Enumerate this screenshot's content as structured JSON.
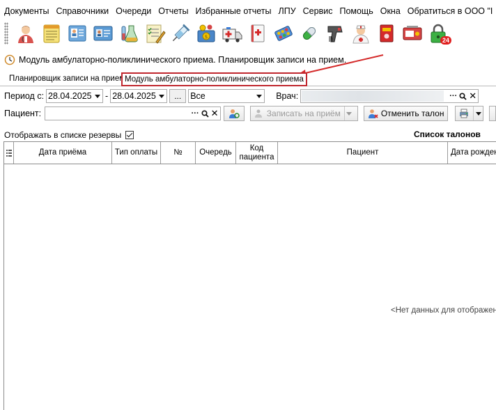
{
  "menu": {
    "items": [
      "Документы",
      "Справочники",
      "Очереди",
      "Отчеты",
      "Избранные отчеты",
      "ЛПУ",
      "Сервис",
      "Помощь",
      "Окна",
      "Обратиться в ООО \"I"
    ]
  },
  "toolbar": {
    "icons": [
      "doctor-icon",
      "notepad-icon",
      "contacts-card-icon",
      "id-card-icon",
      "lab-flask-icon",
      "checklist-icon",
      "syringe-icon",
      "money-box-icon",
      "ambulance-icon",
      "medical-book-icon",
      "pill-pack-icon",
      "capsule-icon",
      "barcode-scanner-icon",
      "nurse-icon",
      "red-book-icon",
      "card-reader-icon",
      "lock-notify-icon"
    ],
    "badge": "24"
  },
  "window": {
    "title": "Модуль амбулаторно-поликлинического приема. Планировщик записи на прием."
  },
  "tabs": [
    "Планировщик записи на прием",
    "Модуль амбулаторно-поликлинического приема"
  ],
  "filters": {
    "period_label": "Период с:",
    "date_from": "28.04.2025",
    "dash": "-",
    "date_to": "28.04.2025",
    "dots": "...",
    "payment_value": "Все",
    "doctor_label": "Врач:",
    "patient_label": "Пациент:",
    "ellipsis": "···",
    "clear": "✕"
  },
  "actions": {
    "book_label": "Записать на приём",
    "cancel_label": "Отменить талон"
  },
  "options": {
    "show_reserves_label": "Отображать в списке резервы",
    "list_title": "Список талонов"
  },
  "grid": {
    "columns": [
      "Дата приёма",
      "Тип оплаты",
      "№",
      "Очередь",
      "Код пациента",
      "Пациент",
      "Дата рожден"
    ],
    "empty_text": "<Нет данных для отображени"
  },
  "colors": {
    "highlight_border": "#c0262d",
    "arrow": "#d42a2a"
  }
}
